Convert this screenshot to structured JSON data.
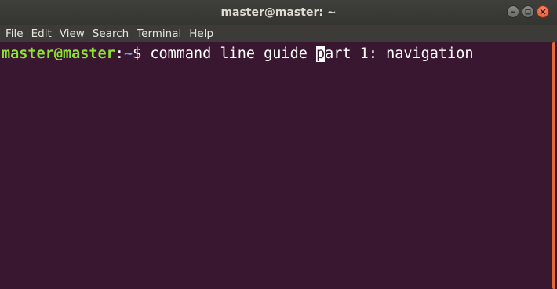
{
  "window": {
    "title": "master@master: ~",
    "buttons": {
      "minimize_icon": "minimize-icon",
      "maximize_icon": "maximize-icon",
      "close_icon": "close-icon"
    }
  },
  "menu": {
    "items": [
      "File",
      "Edit",
      "View",
      "Search",
      "Terminal",
      "Help"
    ]
  },
  "terminal": {
    "prompt_user": "master@master",
    "prompt_colon": ":",
    "prompt_path": "~",
    "prompt_symbol": "$ ",
    "command_before_cursor": "command line guide ",
    "cursor_char": "p",
    "command_after_cursor": "art 1: navigation"
  },
  "colors": {
    "terminal_background": "#3a1730",
    "prompt_user": "#8ae234",
    "prompt_path": "#729fcf",
    "scrollbar_accent": "#e06a3a"
  }
}
